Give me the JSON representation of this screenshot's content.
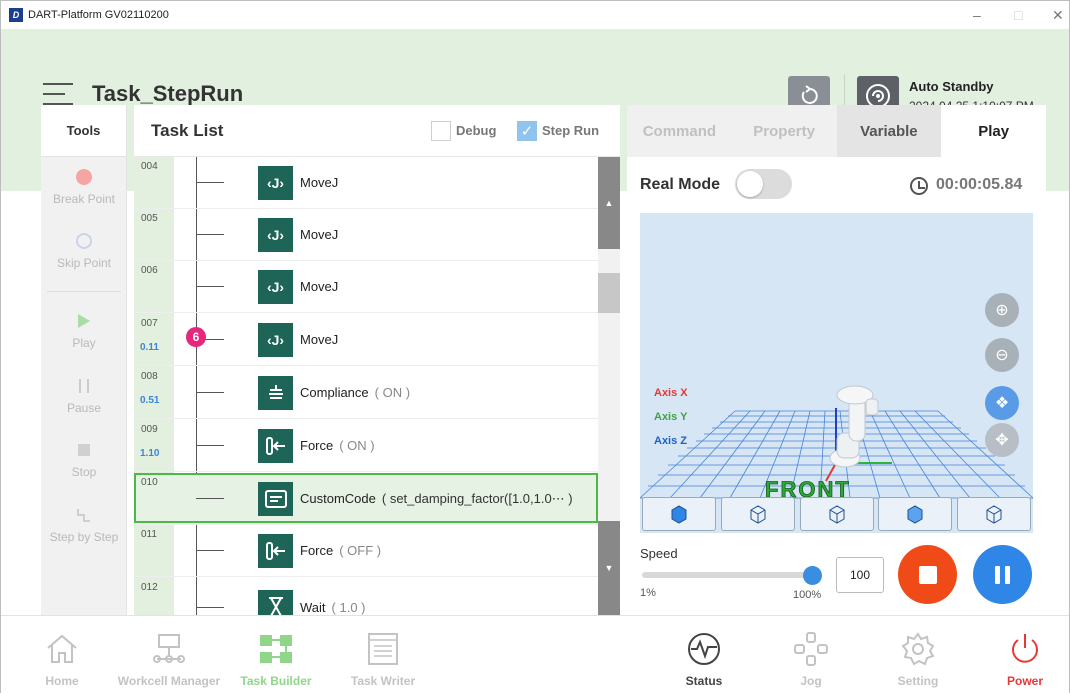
{
  "window": {
    "title": "DART-Platform GV02110200",
    "logo_letter": "D"
  },
  "header": {
    "page_title": "Task_StepRun",
    "status_title": "Auto Standby",
    "status_time": "2024.04.25 1:10:07 PM"
  },
  "tools": {
    "title": "Tools",
    "items": [
      {
        "label": "Break Point",
        "icon": "break-point-icon"
      },
      {
        "label": "Skip Point",
        "icon": "skip-point-icon"
      },
      {
        "label": "Play",
        "icon": "play-icon"
      },
      {
        "label": "Pause",
        "icon": "pause-icon"
      },
      {
        "label": "Stop",
        "icon": "stop-icon"
      },
      {
        "label": "Step by Step",
        "icon": "step-by-step-icon"
      }
    ]
  },
  "task_list": {
    "title": "Task List",
    "debug_label": "Debug",
    "debug_checked": false,
    "steprun_label": "Step Run",
    "steprun_checked": true,
    "rows": [
      {
        "num": "004",
        "time": "",
        "name": "MoveJ",
        "arg": "",
        "icon": "movej-icon"
      },
      {
        "num": "005",
        "time": "",
        "name": "MoveJ",
        "arg": "",
        "icon": "movej-icon"
      },
      {
        "num": "006",
        "time": "",
        "name": "MoveJ",
        "arg": "",
        "icon": "movej-icon"
      },
      {
        "num": "007",
        "time": "0.11",
        "name": "MoveJ",
        "arg": "",
        "icon": "movej-icon",
        "badge": "6"
      },
      {
        "num": "008",
        "time": "0.51",
        "name": "Compliance",
        "arg": "( ON )",
        "icon": "compliance-icon"
      },
      {
        "num": "009",
        "time": "1.10",
        "name": "Force",
        "arg": "( ON )",
        "icon": "force-icon"
      },
      {
        "num": "010",
        "time": "",
        "name": "CustomCode",
        "arg": "( set_damping_factor([1.0,1.0⋯ )",
        "icon": "custom-code-icon",
        "selected": true
      },
      {
        "num": "011",
        "time": "",
        "name": "Force",
        "arg": "( OFF )",
        "icon": "force-icon"
      },
      {
        "num": "012",
        "time": "",
        "name": "Wait",
        "arg": "( 1.0 )",
        "icon": "wait-icon"
      }
    ]
  },
  "right_panel": {
    "tabs": [
      "Command",
      "Property",
      "Variable",
      "Play"
    ],
    "active_tab": "Play",
    "real_mode_label": "Real Mode",
    "real_mode_on": false,
    "timer": "00:00:05.84",
    "axis_x": "Axis X",
    "axis_y": "Axis Y",
    "axis_z": "Axis Z",
    "front_label": "FRONT",
    "speed_label": "Speed",
    "speed_min": "1%",
    "speed_max": "100%",
    "speed_value": "100",
    "speed_level": 1.0,
    "colors": {
      "axis_x": "#e53935",
      "axis_y": "#43a047",
      "axis_z": "#1e60c8",
      "stop": "#f04a18",
      "pause": "#2f86e6"
    }
  },
  "bottom_nav": {
    "items": [
      {
        "label": "Home",
        "icon": "home-icon"
      },
      {
        "label": "Workcell Manager",
        "icon": "workcell-manager-icon"
      },
      {
        "label": "Task Builder",
        "icon": "task-builder-icon",
        "active": true
      },
      {
        "label": "Task Writer",
        "icon": "task-writer-icon"
      },
      {
        "label": "Status",
        "icon": "status-icon"
      },
      {
        "label": "Jog",
        "icon": "jog-icon"
      },
      {
        "label": "Setting",
        "icon": "setting-icon"
      },
      {
        "label": "Power",
        "icon": "power-icon"
      }
    ]
  },
  "colors": {
    "header_bg": "#e2f1df",
    "accent_green": "#4cb848",
    "command_icon_bg": "#1e6457"
  }
}
